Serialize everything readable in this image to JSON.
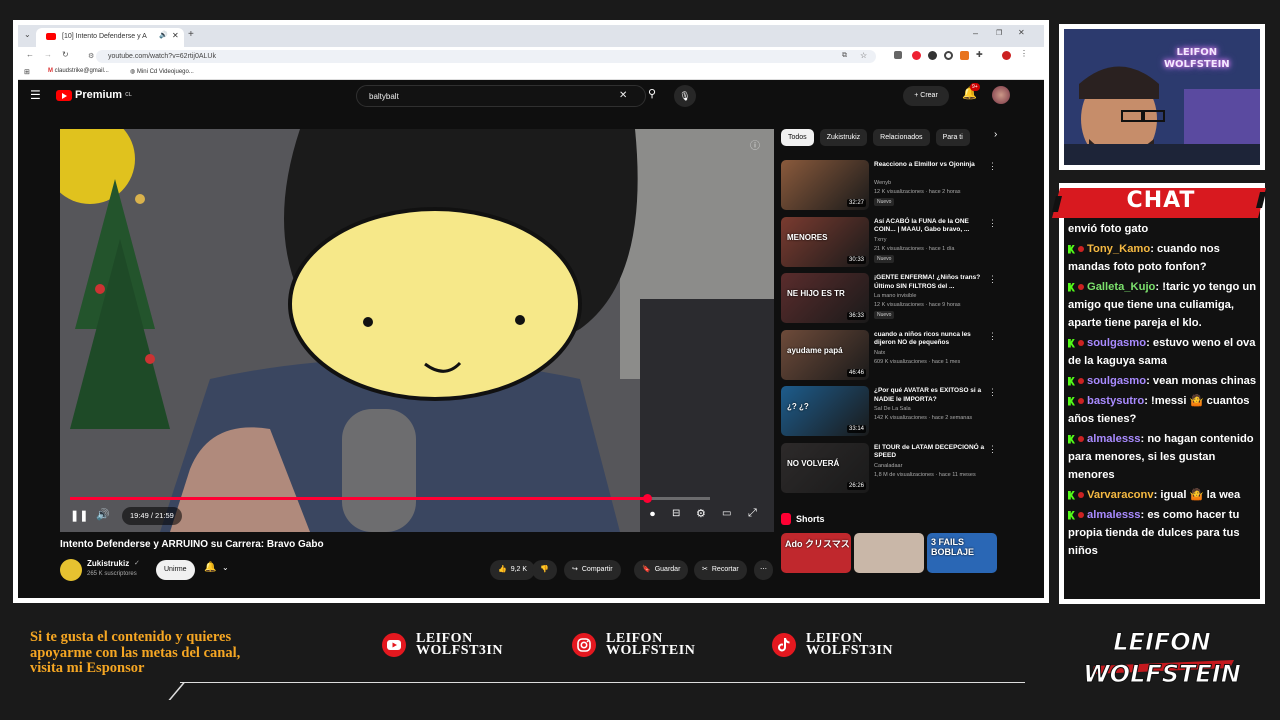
{
  "browser": {
    "tab_title": "[10] Intento Defenderse y A",
    "url": "youtube.com/watch?v=62rtij0ALUk",
    "bookmarks": [
      "claudstrike@gmail...",
      "Mini Cd Videojuego..."
    ]
  },
  "youtube": {
    "logo": "Premium",
    "logo_sup": "CL",
    "search_value": "baltybalt",
    "create_label": "Crear",
    "notif_count": "9+"
  },
  "video": {
    "time": "19:49 / 21:59",
    "progress": 0.902,
    "title": "Intento Defenderse y ARRUINO su Carrera: Bravo Gabo",
    "channel": "Zukistrukiz",
    "subscribers": "265 K suscriptores",
    "join_label": "Unirme",
    "likes": "9,2 K",
    "share_label": "Compartir",
    "save_label": "Guardar",
    "clip_label": "Recortar"
  },
  "chips": [
    "Todos",
    "Zukistrukiz",
    "Relacionados",
    "Para ti"
  ],
  "recommendations": [
    {
      "title": "Reacciono a Elmillor vs Ojoninja",
      "channel": "Wenyb",
      "meta": "12 K visualizaciones · hace 2 horas",
      "badge": "Nuevo",
      "duration": "32:27",
      "thumb_color": "#8a5a3c"
    },
    {
      "title": "Así ACABÓ la FUNA de la ONE COIN... | MAAU, Gabo bravo, ...",
      "channel": "Txrry",
      "meta": "21 K visualizaciones · hace 1 día",
      "badge": "Nuevo",
      "duration": "30:33",
      "thumb_color": "#7a3b30",
      "overlay": "MENORES"
    },
    {
      "title": "¡GENTE ENFERMA! ¿Niños trans? Último SIN FILTROS del ...",
      "channel": "La mano invisible",
      "meta": "12 K visualizaciones · hace 9 horas",
      "badge": "Nuevo",
      "duration": "36:33",
      "thumb_color": "#5a2c2c",
      "overlay": "NE HIJO ES TR"
    },
    {
      "title": "cuando a niños ricos nunca les dijeron NO de pequeños",
      "channel": "Natx",
      "meta": "609 K visualizaciones · hace 1 mes",
      "badge": "",
      "duration": "46:46",
      "thumb_color": "#6e4b3a",
      "overlay": "ayudame papá"
    },
    {
      "title": "¿Por qué AVATAR es EXITOSO si a NADIE le IMPORTA?",
      "channel": "Sal De La Sala",
      "meta": "142 K visualizaciones · hace 2 semanas",
      "badge": "",
      "duration": "33:14",
      "thumb_color": "#1d5c8c",
      "overlay": "¿? ¿?"
    },
    {
      "title": "El TOUR de LATAM DECEPCIONÓ a SPEED",
      "channel": "Canaladaar",
      "meta": "1,8 M de visualizaciones · hace 11 meses",
      "badge": "",
      "duration": "26:26",
      "thumb_color": "#2d2a2a",
      "overlay": "NO VOLVERÁ"
    }
  ],
  "shorts": {
    "heading": "Shorts",
    "items": [
      {
        "label": "Ado クリスマス",
        "color": "#c0282d"
      },
      {
        "label": "",
        "color": "#c9b7a8"
      },
      {
        "label": "3 FAILS BOBLAJE",
        "color": "#2a67b5"
      }
    ]
  },
  "cam": {
    "neon_line1": "LEIFON",
    "neon_line2": "WOLFSTEIN"
  },
  "chat": {
    "title": "CHAT",
    "messages": [
      {
        "user": "",
        "text": "envió foto gato",
        "color": "#ffffff"
      },
      {
        "user": "Tony_Kamo",
        "text": ": cuando nos mandas foto poto fonfon?",
        "color": "#f5b942"
      },
      {
        "user": "Galleta_Kujo",
        "text": ": !taric yo tengo un amigo que tiene una culiamiga, aparte tiene pareja el klo.",
        "color": "#7be06c"
      },
      {
        "user": "soulgasmo",
        "text": ": estuvo weno el ova de la kaguya sama",
        "color": "#a98bff"
      },
      {
        "user": "soulgasmo",
        "text": ": vean monas chinas",
        "color": "#a98bff"
      },
      {
        "user": "bastysutro",
        "text": ": !messi 🤷 cuantos años tienes?",
        "color": "#a98bff"
      },
      {
        "user": "almalesss",
        "text": ": no hagan contenido para menores, si les gustan menores",
        "color": "#a98bff"
      },
      {
        "user": "Varvaraconv",
        "text": ": igual 🤷 la wea",
        "color": "#f5b942"
      },
      {
        "user": "almalesss",
        "text": ": es como hacer tu propia tienda de dulces para tus niños",
        "color": "#a98bff"
      }
    ]
  },
  "footer": {
    "sponsor_line1": "Si te gusta el contenido y quieres",
    "sponsor_line2": "apoyarme con las metas del canal,",
    "sponsor_line3": "visita mi Esponsor",
    "youtube_name_1": "LEIFON",
    "youtube_name_2": "WOLFST3IN",
    "instagram_name_1": "LEIFON",
    "instagram_name_2": "WOLFSTEIN",
    "tiktok_name_1": "LEIFON",
    "tiktok_name_2": "WOLFST3IN",
    "logo_line1": "LEIFON",
    "logo_line2": "WOLFSTEIN"
  },
  "colors": {
    "accent": "#ff0033",
    "chat_banner": "#d8191f",
    "sponsor": "#f5a623"
  }
}
